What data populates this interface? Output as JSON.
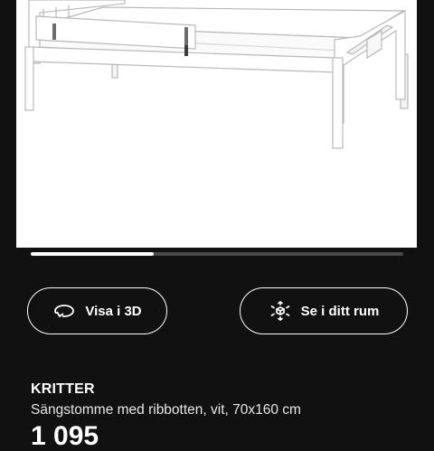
{
  "product_image": {
    "alt": "KRITTER"
  },
  "carousel": {
    "progress": 0.33
  },
  "actions": {
    "view_3d_label": "Visa i 3D",
    "view_3d_icon": "rotate-3d-icon",
    "see_in_room_label": "Se i ditt rum",
    "see_in_room_icon": "ar-cube-icon"
  },
  "product": {
    "name": "KRITTER",
    "description": "Sängstomme med ribbotten, vit, 70x160 cm",
    "price_partial": "1 095"
  },
  "colors": {
    "background": "#111111",
    "foreground": "#ffffff",
    "track": "#4a4a4a"
  }
}
